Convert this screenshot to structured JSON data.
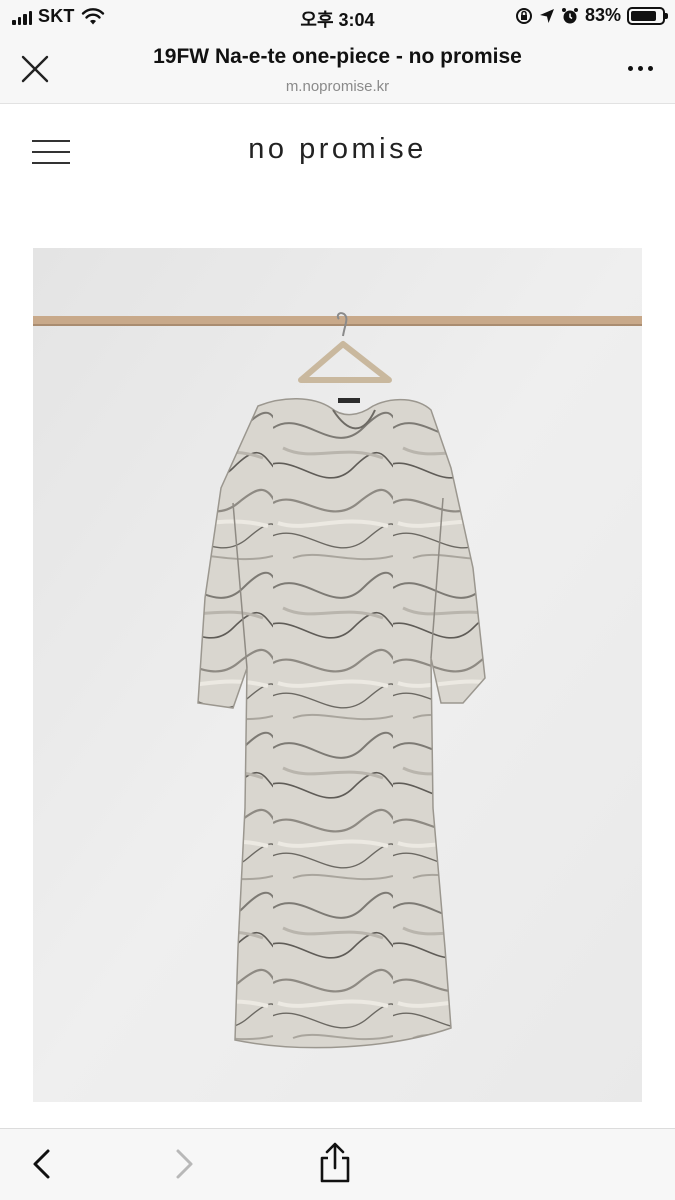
{
  "status_bar": {
    "carrier": "SKT",
    "time": "오후 3:04",
    "battery_percent": "83%",
    "battery_level": 0.83,
    "icons": [
      "signal-icon",
      "wifi-icon",
      "orientation-lock-icon",
      "location-icon",
      "alarm-icon",
      "battery-icon"
    ]
  },
  "browser": {
    "page_title": "19FW Na-e-te one-piece - no promise",
    "url": "m.nopromise.kr",
    "close_icon": "close-icon",
    "more_icon": "more-icon"
  },
  "site": {
    "brand": "no promise",
    "menu_icon": "menu-icon"
  },
  "product": {
    "image_description_icon": "product-image"
  },
  "toolbar": {
    "icons": [
      "back-icon",
      "forward-icon",
      "share-icon"
    ]
  },
  "colors": {
    "bar_background": "#f7f7f7",
    "disabled_icon": "#b8b8b8",
    "rail": "#c8a98a"
  }
}
